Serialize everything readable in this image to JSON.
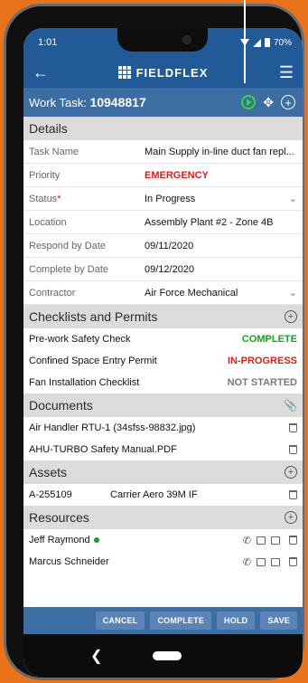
{
  "status_bar": {
    "time": "1:01",
    "battery": "70%"
  },
  "app": {
    "name": "FIELDFLEX"
  },
  "task": {
    "label": "Work Task:",
    "number": "10948817"
  },
  "details": {
    "title": "Details",
    "rows": [
      {
        "label": "Task Name",
        "value": "Main Supply in-line duct fan repl..."
      },
      {
        "label": "Priority",
        "value": "EMERGENCY"
      },
      {
        "label": "Status",
        "value": "In Progress"
      },
      {
        "label": "Location",
        "value": "Assembly Plant #2 - Zone 4B"
      },
      {
        "label": "Respond by Date",
        "value": "09/11/2020"
      },
      {
        "label": "Complete by Date",
        "value": "09/12/2020"
      },
      {
        "label": "Contractor",
        "value": "Air Force Mechanical"
      }
    ]
  },
  "checklists": {
    "title": "Checklists and Permits",
    "items": [
      {
        "name": "Pre-work Safety Check",
        "status": "COMPLETE"
      },
      {
        "name": "Confined Space Entry Permit",
        "status": "IN-PROGRESS"
      },
      {
        "name": "Fan Installation Checklist",
        "status": "NOT STARTED"
      }
    ]
  },
  "documents": {
    "title": "Documents",
    "items": [
      {
        "name": "Air Handler RTU-1 (34sfss-98832.jpg)"
      },
      {
        "name": "AHU-TURBO Safety Manual.PDF"
      }
    ]
  },
  "assets": {
    "title": "Assets",
    "items": [
      {
        "id": "A-255109",
        "name": "Carrier Aero 39M IF"
      }
    ]
  },
  "resources": {
    "title": "Resources",
    "items": [
      {
        "name": "Jeff Raymond"
      },
      {
        "name": "Marcus Schneider"
      }
    ]
  },
  "footer": {
    "cancel": "CANCEL",
    "complete": "COMPLETE",
    "hold": "HOLD",
    "save": "SAVE"
  },
  "colors": {
    "primary": "#215a96",
    "secondary": "#3d6ea3",
    "complete": "#1f9a2a",
    "alert": "#d32020",
    "background": "#e8731a"
  }
}
